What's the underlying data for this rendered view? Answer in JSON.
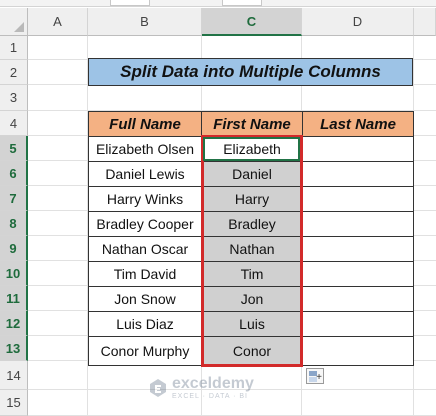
{
  "columns": [
    "A",
    "B",
    "C",
    "D"
  ],
  "selected_column": "C",
  "rows": [
    "1",
    "2",
    "3",
    "4",
    "5",
    "6",
    "7",
    "8",
    "9",
    "10",
    "11",
    "12",
    "13",
    "14",
    "15"
  ],
  "selected_rows": [
    "5",
    "6",
    "7",
    "8",
    "9",
    "10",
    "11",
    "12",
    "13"
  ],
  "title": "Split Data into Multiple Columns",
  "table": {
    "headers": {
      "full_name": "Full Name",
      "first_name": "First Name",
      "last_name": "Last Name"
    },
    "rows": [
      {
        "full_name": "Elizabeth Olsen",
        "first_name": "Elizabeth",
        "last_name": ""
      },
      {
        "full_name": "Daniel Lewis",
        "first_name": "Daniel",
        "last_name": ""
      },
      {
        "full_name": "Harry Winks",
        "first_name": "Harry",
        "last_name": ""
      },
      {
        "full_name": "Bradley Cooper",
        "first_name": "Bradley",
        "last_name": ""
      },
      {
        "full_name": "Nathan Oscar",
        "first_name": "Nathan",
        "last_name": ""
      },
      {
        "full_name": "Tim David",
        "first_name": "Tim",
        "last_name": ""
      },
      {
        "full_name": "Jon Snow",
        "first_name": "Jon",
        "last_name": ""
      },
      {
        "full_name": "Luis Diaz",
        "first_name": "Luis",
        "last_name": ""
      },
      {
        "full_name": "Conor Murphy",
        "first_name": "Conor",
        "last_name": ""
      }
    ]
  },
  "colors": {
    "title_fill": "#9dc3e6",
    "header_fill": "#f4b183",
    "selection_fill": "#d0d0d0",
    "highlight_border": "#d22a2a",
    "excel_green": "#217346"
  },
  "flash_fill_icon": "flash-fill-options-icon",
  "watermark": {
    "name": "exceldemy",
    "tagline": "EXCEL · DATA · BI"
  }
}
